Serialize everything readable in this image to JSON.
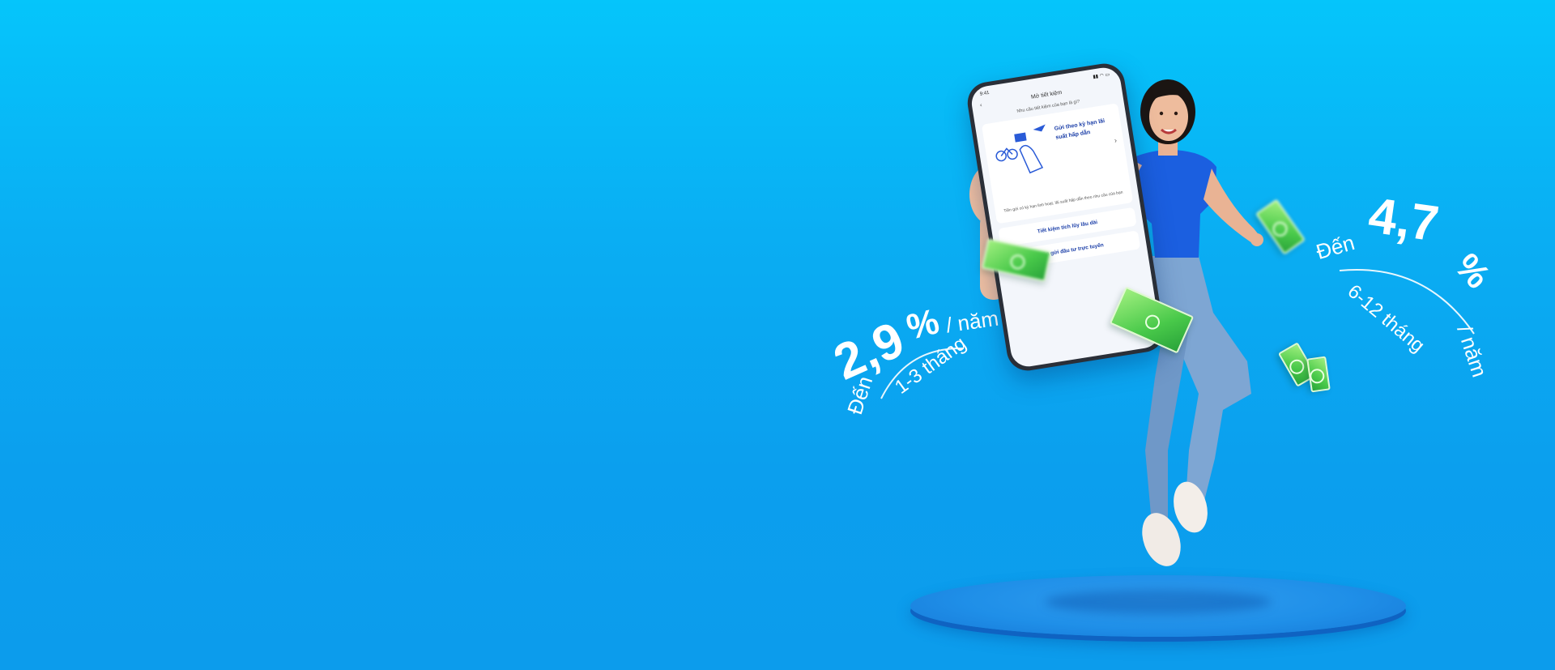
{
  "colors": {
    "background_top": "#05c5fb",
    "background_bottom": "#0c9cec",
    "money_green": "#49c94a",
    "app_blue": "#1c3fa8"
  },
  "promo_left": {
    "prefix": "Đến",
    "rate": "2,9",
    "percent": "%",
    "per_year": "/ năm",
    "term": "1-3 tháng"
  },
  "promo_right": {
    "prefix": "Đến",
    "rate": "4,7",
    "percent": "%",
    "per_year": "/ năm",
    "term": "6-12 tháng"
  },
  "phone": {
    "time": "9:41",
    "nav_title": "Mở tiết kiệm",
    "question": "Nhu cầu tiết kiệm của bạn là gì?",
    "card_title": "Gửi theo kỳ hạn lãi suất hấp dẫn",
    "card_desc": "Tiền gửi có kỳ hạn linh hoạt, lãi suất hấp dẫn theo nhu cầu của bạn",
    "option_1": "Tiết kiệm tích lũy lâu dài",
    "option_2": "Tiền gửi đầu tư trực tuyến",
    "icons": [
      "back-arrow",
      "chevron-right",
      "signal",
      "wifi",
      "battery"
    ]
  }
}
